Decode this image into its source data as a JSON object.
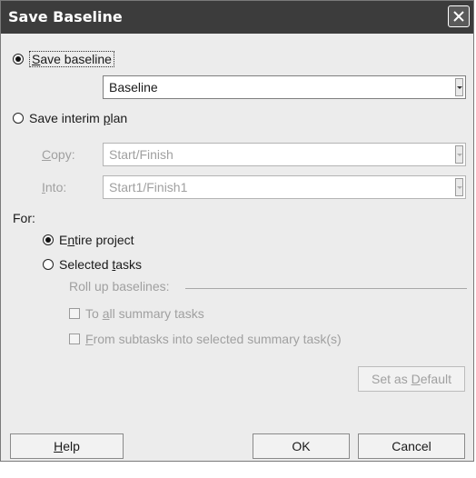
{
  "dialog": {
    "title": "Save Baseline",
    "close_icon": "close-icon"
  },
  "baseline": {
    "radio_label": "Save baseline",
    "selected": "Baseline"
  },
  "interim": {
    "radio_label": "Save interim plan",
    "copy_label": "Copy:",
    "copy_value": "Start/Finish",
    "into_label": "Into:",
    "into_value": "Start1/Finish1"
  },
  "for": {
    "label": "For:",
    "entire_project": "Entire project",
    "selected_tasks": "Selected tasks",
    "selected_option": "Entire project"
  },
  "rollup": {
    "label": "Roll up baselines:",
    "to_all_summary": "To all summary tasks",
    "from_subtasks": "From subtasks into selected summary task(s)"
  },
  "buttons": {
    "set_default": "Set as Default",
    "help": "Help",
    "ok": "OK",
    "cancel": "Cancel"
  }
}
